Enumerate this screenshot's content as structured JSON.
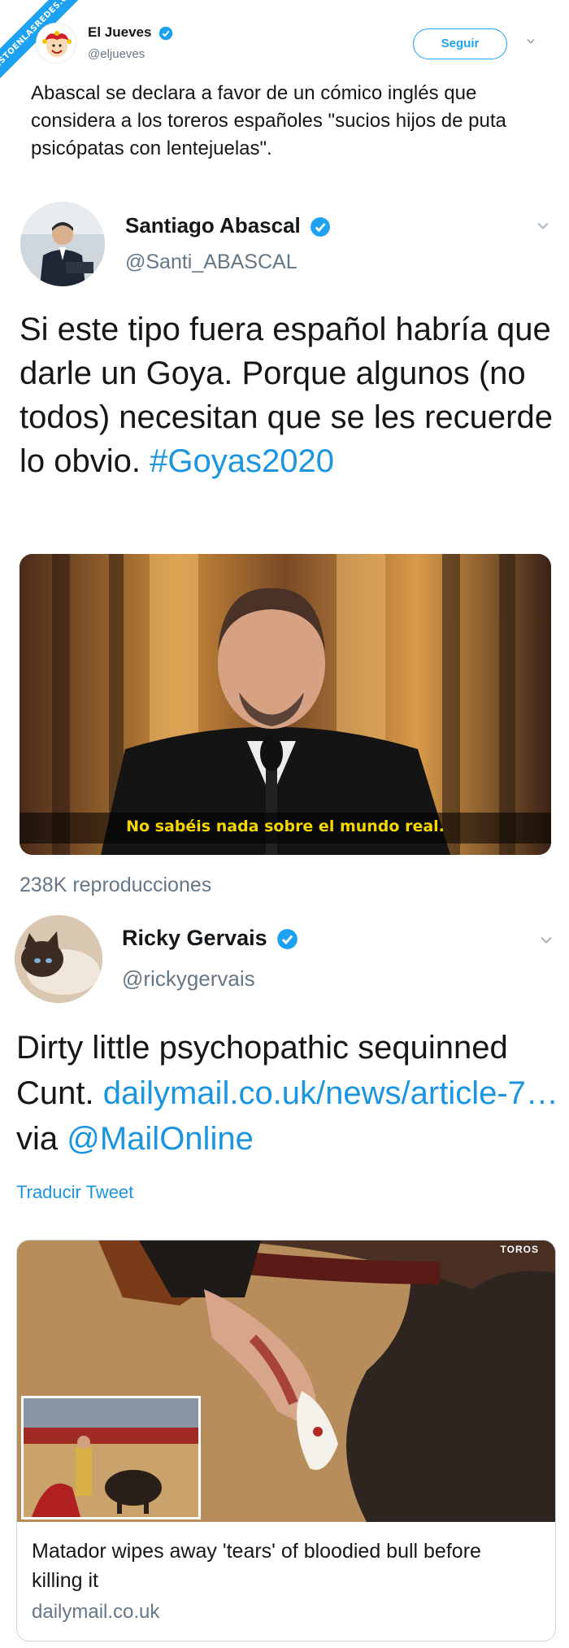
{
  "watermark": "VISTOENLASREDES.com",
  "tweet": {
    "name": "El Jueves",
    "handle": "@eljueves",
    "follow_label": "Seguir",
    "text": "Abascal se declara a favor de un cómico inglés que considera a los toreros españoles \"sucios hijos de puta psicópatas con lentejuelas\"."
  },
  "quoted1": {
    "name": "Santiago Abascal",
    "handle": "@Santi_ABASCAL",
    "text": "Si este tipo fuera español habría que darle un Goya. Porque algunos (no todos) necesitan que se les recuerde lo obvio. ",
    "hashtag": "#Goyas2020",
    "video_subtitle": "No sabéis nada sobre el mundo real.",
    "views": "238K reproducciones"
  },
  "quoted2": {
    "name": "Ricky Gervais",
    "handle": "@rickygervais",
    "text_before": "Dirty little psychopathic sequinned Cunt. ",
    "link_text": "dailymail.co.uk/news/article-7…",
    "via_text": " via ",
    "mention": "@MailOnline",
    "translate_label": "Traducir Tweet",
    "card": {
      "title": "Matador wipes away 'tears' of bloodied bull before killing it",
      "domain": "dailymail.co.uk",
      "image_watermark": "TOROS"
    }
  },
  "colors": {
    "accent": "#1da1f2",
    "link": "#1b95e0",
    "muted": "#657786",
    "text": "#14171a"
  }
}
